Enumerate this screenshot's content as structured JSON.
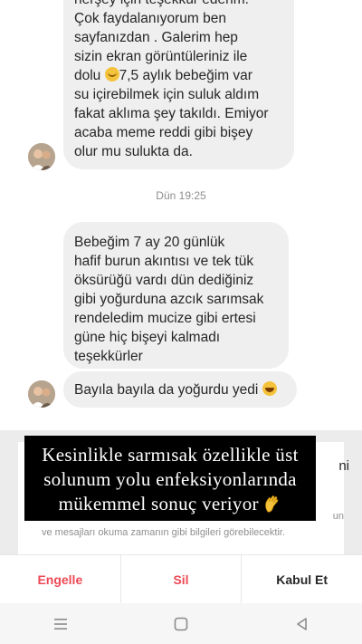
{
  "messages": [
    {
      "lines": [
        "herşey için teşekkür ederim.",
        "Çok faydalanıyorum ben",
        "sayfanızdan . Galerim hep",
        "sizin ekran görüntüleriniz ile",
        "dolu ",
        "7,5 aylık bebeğim var",
        "su içirebilmek için suluk aldım",
        "fakat aklıma şey takıldı. Emiyor",
        "acaba meme reddi gibi bişey",
        "olur mu sulukta da."
      ]
    },
    {
      "lines": [
        "Bebeğim 7 ay 20 günlük",
        "hafif burun akıntısı ve tek tük",
        "öksürüğü vardı dün dediğiniz",
        "gibi yoğurduna azcık sarımsak",
        "rendeledim mucize gibi ertesi",
        "güne hiç bişeyi kalmadı",
        "teşekkürler"
      ]
    },
    {
      "text": "Bayıla bayıla da yoğurdu yedi "
    }
  ],
  "timestamp": "Dün 19:25",
  "request": {
    "edge_fragment": "ni",
    "edge_fragment2": "un",
    "visible_text": "ve mesajları okuma zamanın gibi bilgileri görebilecektir."
  },
  "actions": {
    "block": "Engelle",
    "delete": "Sil",
    "accept": "Kabul Et"
  },
  "overlay": {
    "lines": [
      "Kesinlikle sarmısak özellikle üst",
      "solunum yolu enfeksiyonlarında",
      "mükemmel sonuç veriyor "
    ]
  },
  "colors": {
    "bubble": "#efefef",
    "danger": "#ed4956",
    "overlay_bg": "#000000"
  },
  "icons": [
    "hug-emoji-icon",
    "laughing-emoji-icon",
    "waving-hand-icon",
    "menu-icon",
    "home-icon",
    "back-icon"
  ]
}
